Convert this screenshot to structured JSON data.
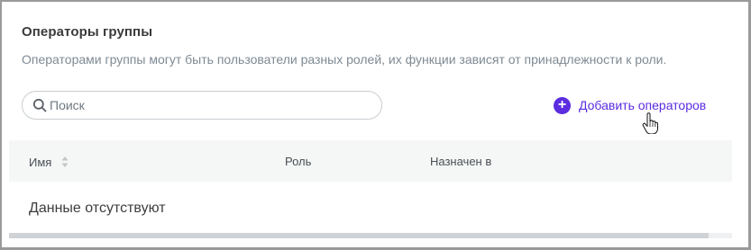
{
  "section": {
    "title": "Операторы группы",
    "subtitle": "Операторами группы могут быть пользователи разных ролей, их функции зависят от принадлежности к роли."
  },
  "search": {
    "placeholder": "Поиск",
    "icon": "search-icon"
  },
  "add_button": {
    "label": "Добавить операторов",
    "icon": "plus-circle-icon",
    "accent": "#5b2ce0"
  },
  "table": {
    "columns": [
      "Имя",
      "Роль",
      "Назначен в"
    ],
    "empty_text": "Данные отсутствуют"
  }
}
